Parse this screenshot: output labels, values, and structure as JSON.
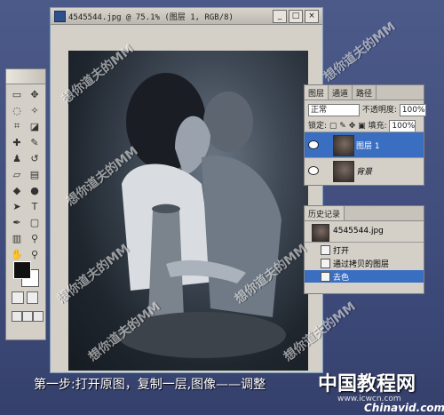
{
  "document": {
    "title": "4545544.jpg @ 75.1% (图层 1, RGB/8)",
    "minimize_glyph": "_",
    "maximize_glyph": "□",
    "close_glyph": "×"
  },
  "layers_panel": {
    "tabs": [
      "图层",
      "通道",
      "路径"
    ],
    "blend_mode": "正常",
    "opacity_label": "不透明度:",
    "opacity_value": "100%",
    "lock_label": "锁定:",
    "fill_label": "填充:",
    "fill_value": "100%",
    "layers": [
      {
        "name": "图层 1",
        "selected": true
      },
      {
        "name": "背景",
        "selected": false
      }
    ]
  },
  "history_panel": {
    "tab": "历史记录",
    "snapshot": "4545544.jpg",
    "items": [
      {
        "label": "打开",
        "selected": false
      },
      {
        "label": "通过拷贝的图层",
        "selected": false
      },
      {
        "label": "去色",
        "selected": true
      }
    ]
  },
  "watermark_text": "想你道夫的MM",
  "caption": {
    "step_text": "第一步:打开原图，复制一层,图像——调整",
    "brand_text": "中国教程网",
    "brand_url": "www.icwcn.com",
    "brand_sub": "Chinavid.com"
  },
  "icons": [
    "photoshop-icon",
    "eye-icon",
    "layer-thumbnail",
    "history-brush-icon"
  ],
  "colors": {
    "selection": "#3a6ec1",
    "workspace": "#4c5a8a",
    "panel": "#d4d0c8"
  }
}
